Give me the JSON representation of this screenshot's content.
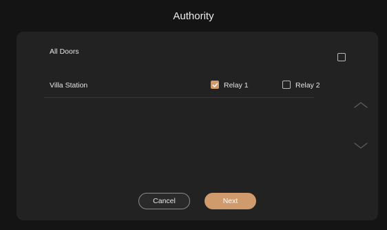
{
  "header": {
    "title": "Authority"
  },
  "rows": {
    "all_doors": {
      "label": "All Doors",
      "checked": false
    },
    "villa_station": {
      "label": "Villa Station",
      "relay1": {
        "label": "Relay 1",
        "checked": true
      },
      "relay2": {
        "label": "Relay 2",
        "checked": false
      }
    }
  },
  "footer": {
    "cancel_label": "Cancel",
    "next_label": "Next"
  },
  "colors": {
    "accent": "#cf9a6c",
    "background": "#141414",
    "panel": "#222222"
  },
  "icons": {
    "scroll_up": "chevron-up-icon",
    "scroll_down": "chevron-down-icon",
    "check": "checkmark-icon"
  }
}
